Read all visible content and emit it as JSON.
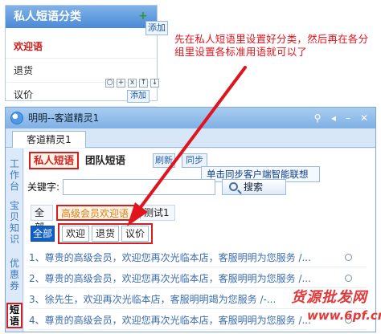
{
  "category_panel": {
    "title": "私人短语分类",
    "items": [
      "欢迎语",
      "退货",
      "议价"
    ],
    "add_tooltip": "添加",
    "row_tools": [
      "○",
      "+",
      "x",
      "↑",
      "↓"
    ],
    "row_add_tooltip": "添加"
  },
  "annotation": "先在私人短语里设置好分类，然后再在各分组里设置各标准用语就可以了",
  "window": {
    "title": "明明--客道精灵1",
    "tab": "客道精灵1",
    "side_menu": [
      "工作台",
      "宝贝知识",
      "优惠券",
      "短语"
    ],
    "tabs": {
      "private": "私人短语",
      "team": "团队短语"
    },
    "refresh_label": "刷新",
    "sync_label": "同步",
    "sync_tooltip": "单击同步客户端智能联想",
    "keyword_label": "关键字:",
    "search_label": "搜索",
    "groups": [
      "全部",
      "高级会员欢迎语",
      "测试1"
    ],
    "subtabs": [
      "全部",
      "欢迎",
      "退货",
      "议价"
    ],
    "phrases": [
      "1、尊贵的高级会员，欢迎您再次光临本店，客服明明为您服务 /...",
      "2、尊贵的高级会员，欢迎您再次光临本店，客服明明为您服务 /...",
      "3、徐先生，欢迎再次光临本店，客服明明竭为您服务 /-...",
      "4、尊贵的高级会员，欢迎您再次光临本店，客服明明为您服务 /..."
    ]
  },
  "watermark": {
    "line1": "货源批发网",
    "line2": "www.6pf.cn"
  },
  "colors": {
    "accent_red": "#d22020",
    "title_blue": "#4b8ad6",
    "arrow_red": "#e0141c"
  }
}
